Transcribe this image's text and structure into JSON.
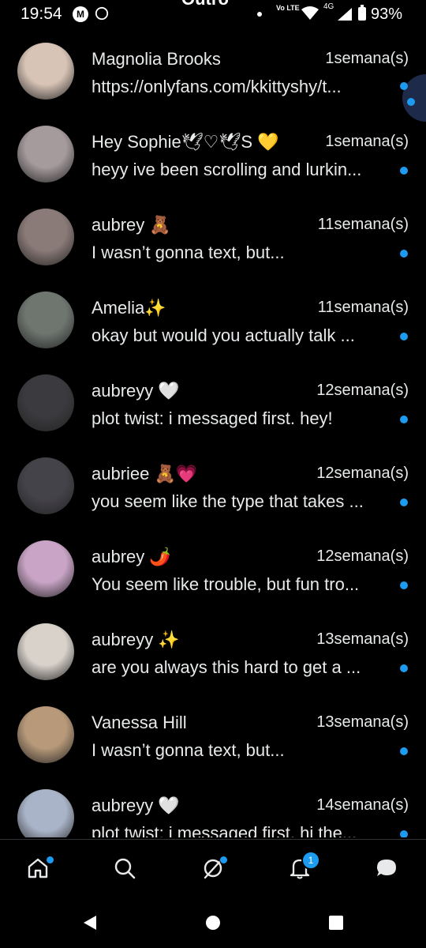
{
  "status_bar": {
    "time": "19:54",
    "header_title": "Outro",
    "volte": "Vo LTE",
    "network": "4G",
    "battery": "93%"
  },
  "conversations": [
    {
      "name": "Magnolia Brooks",
      "time": "1semana(s)",
      "preview": "https://onlyfans.com/kkittyshy/t...",
      "unread": true,
      "avatar_color": "#d8c4b6"
    },
    {
      "name": "Hey Sophie🕊♡🕊S 💛",
      "time": "1semana(s)",
      "preview": "heyy ive been scrolling and lurkin...",
      "unread": true,
      "avatar_color": "#a59a9c"
    },
    {
      "name": "aubrey 🧸",
      "time": "11semana(s)",
      "preview": "I wasn’t gonna text, but...",
      "unread": true,
      "avatar_color": "#8b7b78"
    },
    {
      "name": "Amelia✨",
      "time": "11semana(s)",
      "preview": "okay but would you actually talk ...",
      "unread": true,
      "avatar_color": "#6f7670"
    },
    {
      "name": "aubreyy 🤍",
      "time": "12semana(s)",
      "preview": "plot twist: i messaged first. hey!",
      "unread": true,
      "avatar_color": "#3b3a3e"
    },
    {
      "name": "aubriee 🧸💗",
      "time": "12semana(s)",
      "preview": "you seem like the type that takes ...",
      "unread": true,
      "avatar_color": "#45434a"
    },
    {
      "name": "aubrey 🌶️",
      "time": "12semana(s)",
      "preview": "You seem like trouble, but fun tro...",
      "unread": true,
      "avatar_color": "#c9a4c6"
    },
    {
      "name": "aubreyy ✨",
      "time": "13semana(s)",
      "preview": "are you always this hard to get a ...",
      "unread": true,
      "avatar_color": "#d9d2cb"
    },
    {
      "name": "Vanessa Hill",
      "time": "13semana(s)",
      "preview": "I wasn’t gonna text, but...",
      "unread": true,
      "avatar_color": "#b89a7a"
    },
    {
      "name": "aubreyy 🤍",
      "time": "14semana(s)",
      "preview": "plot twist: i messaged first. hi the...",
      "unread": true,
      "avatar_color": "#aab4c8"
    }
  ],
  "bottom_nav": {
    "items": [
      {
        "name": "home-icon",
        "dot": true
      },
      {
        "name": "search-icon",
        "dot": false
      },
      {
        "name": "grok-icon",
        "dot": true
      },
      {
        "name": "notifications-icon",
        "badge": "1"
      },
      {
        "name": "messages-icon",
        "dot": false
      }
    ]
  },
  "colors": {
    "background": "#000000",
    "text": "#e7e9ea",
    "accent": "#1d9bf0",
    "divider": "#2f3336"
  }
}
